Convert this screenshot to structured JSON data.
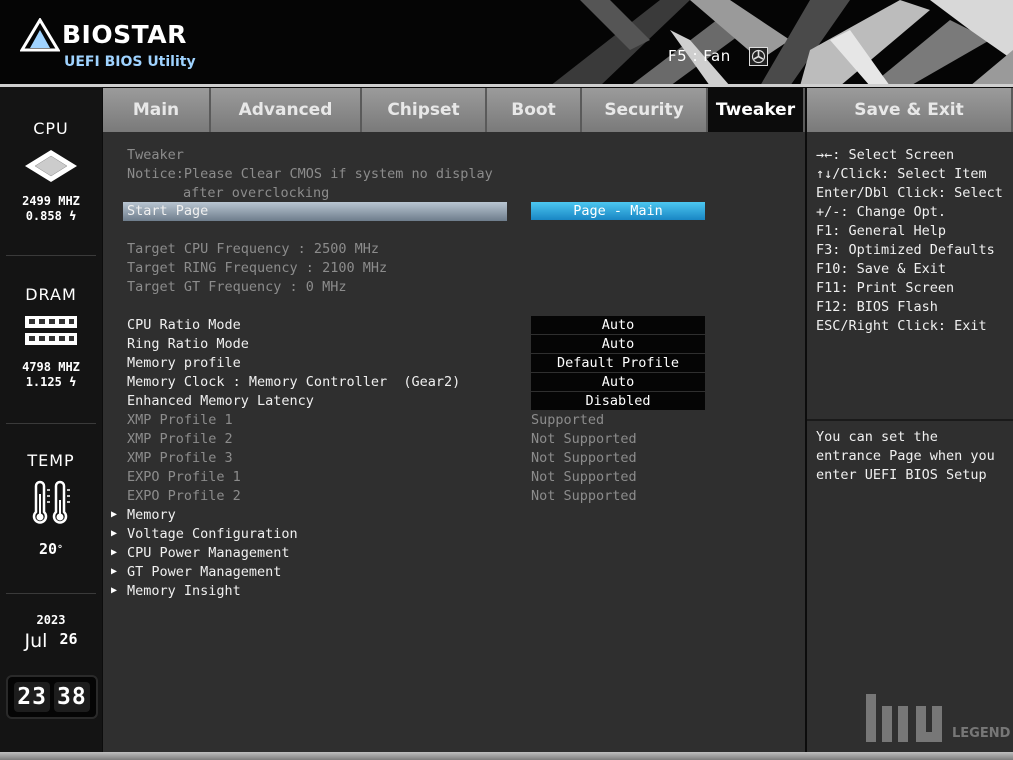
{
  "header": {
    "brand": "BIOSTAR",
    "subtitle": "UEFI BIOS Utility",
    "fan_hint": "F5 : Fan"
  },
  "left_panel": {
    "cpu": {
      "title": "CPU",
      "freq": "2499 MHZ",
      "volt": "0.858"
    },
    "dram": {
      "title": "DRAM",
      "freq": "4798 MHZ",
      "volt": "1.125"
    },
    "temp": {
      "title": "TEMP",
      "value": "20"
    },
    "date": {
      "year": "2023",
      "month": "Jul",
      "day": "26"
    },
    "time": {
      "hour": "23",
      "minute": "38"
    }
  },
  "tabs": [
    "Main",
    "Advanced",
    "Chipset",
    "Boot",
    "Security",
    "Tweaker",
    "Save & Exit"
  ],
  "active_tab": "Tweaker",
  "main": {
    "section_title": "Tweaker",
    "notice_line1": "Notice:Please Clear CMOS if system no display",
    "notice_line2": "after overclocking",
    "start_page": {
      "label": "Start Page",
      "value": "Page - Main"
    },
    "targets": [
      "Target CPU Frequency : 2500 MHz",
      "Target RING Frequency : 2100 MHz",
      "Target GT Frequency : 0 MHz"
    ],
    "settings": [
      {
        "label": "CPU Ratio Mode",
        "value": "Auto"
      },
      {
        "label": "Ring Ratio Mode",
        "value": "Auto"
      },
      {
        "label": "Memory profile",
        "value": "Default Profile"
      },
      {
        "label": "Memory Clock : Memory Controller  (Gear2)",
        "value": "Auto"
      },
      {
        "label": "Enhanced Memory Latency",
        "value": "Disabled"
      }
    ],
    "profiles": [
      {
        "label": "XMP Profile 1",
        "value": "Supported"
      },
      {
        "label": "XMP Profile 2",
        "value": "Not Supported"
      },
      {
        "label": "XMP Profile 3",
        "value": "Not Supported"
      },
      {
        "label": "EXPO Profile 1",
        "value": "Not Supported"
      },
      {
        "label": "EXPO Profile 2",
        "value": "Not Supported"
      }
    ],
    "submenus": [
      "Memory",
      "Voltage Configuration",
      "CPU Power Management",
      "GT Power Management",
      "Memory Insight"
    ]
  },
  "help": {
    "keys": [
      "→←: Select Screen",
      "↑↓/Click: Select Item",
      "Enter/Dbl Click: Select",
      "+/-: Change Opt.",
      "F1: General Help",
      "F3: Optimized Defaults",
      "F10: Save & Exit",
      "F11: Print Screen",
      "F12: BIOS Flash",
      "ESC/Right Click: Exit"
    ],
    "description": "You can set the entrance Page when you enter UEFI BIOS Setup"
  },
  "watermark": {
    "text": "LEGEND"
  },
  "colors": {
    "accent": "#2a9fd6",
    "panel_bg": "#2f2f2f",
    "tab_bg": "#8a8a8a",
    "active_tab_bg": "#0c0c0c"
  }
}
